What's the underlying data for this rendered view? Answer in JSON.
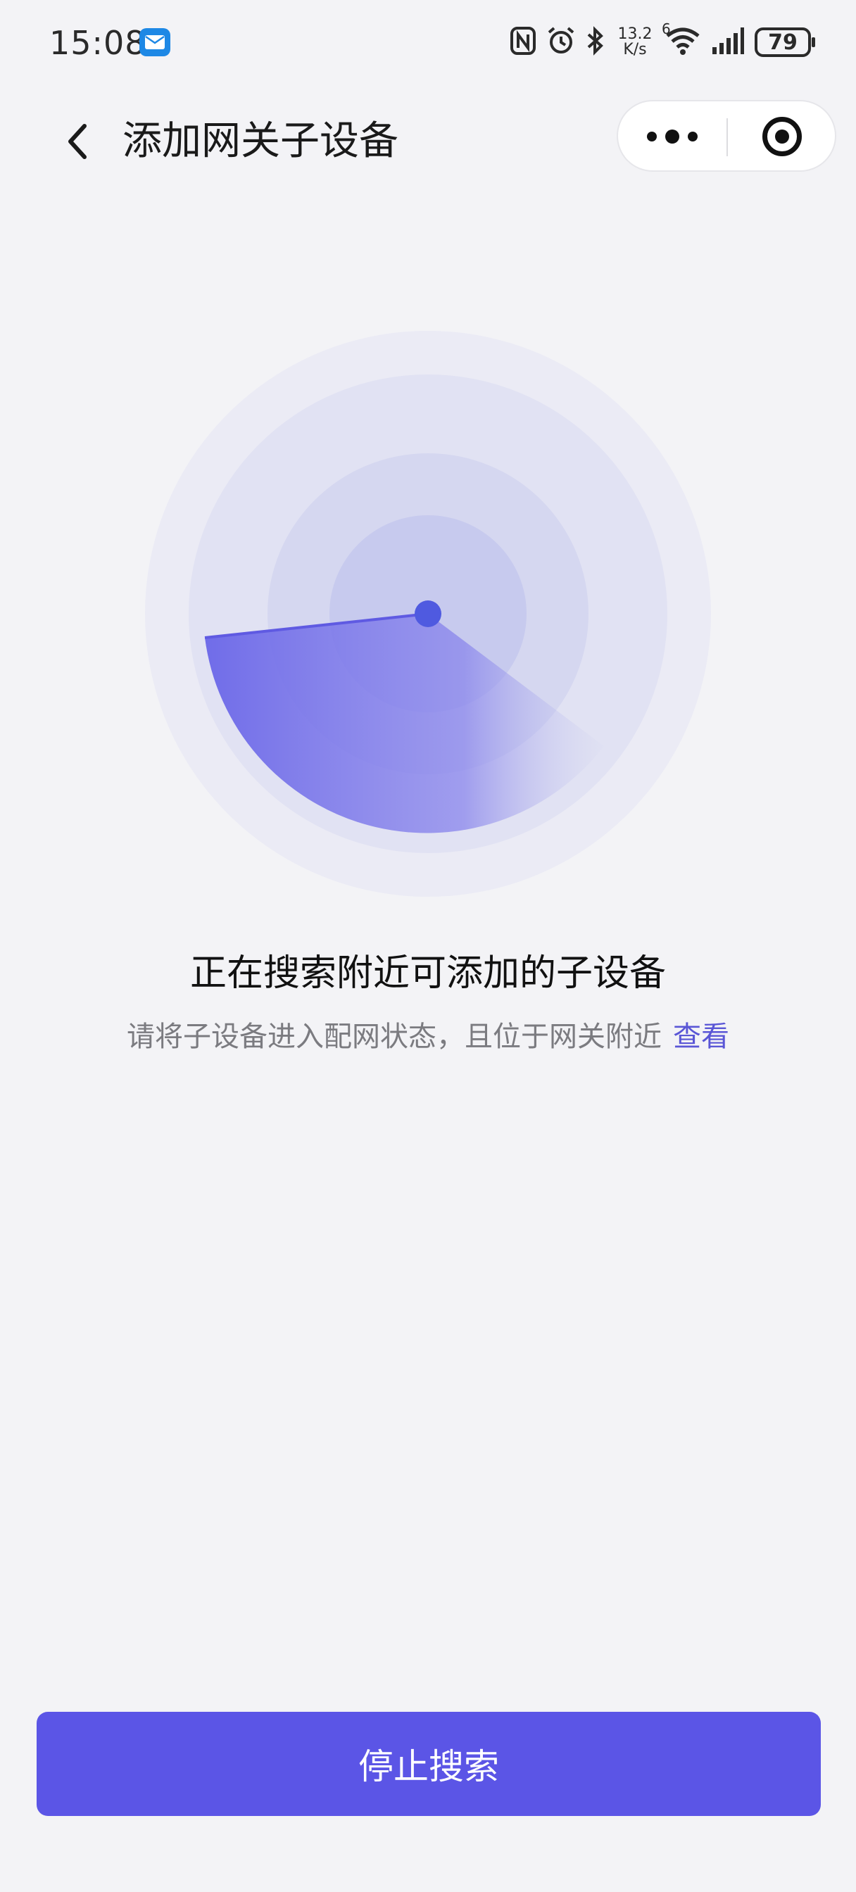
{
  "status_bar": {
    "time": "15:08",
    "net_speed_value": "13.2",
    "net_speed_unit": "K/s",
    "wifi_badge": "6",
    "battery": "79",
    "icons": [
      "mail-icon",
      "nfc-icon",
      "alarm-icon",
      "bluetooth-icon",
      "wifi-icon",
      "signal-icon",
      "battery-icon"
    ]
  },
  "nav": {
    "title": "添加网关子设备",
    "back_icon": "chevron-left-icon",
    "more_icon": "more-dots-icon",
    "close_icon": "target-icon"
  },
  "radar": {
    "colors": {
      "ring_outer": "#ebebf5",
      "ring_2": "#e1e2f3",
      "ring_3": "#d5d7f0",
      "ring_inner": "#c7caee",
      "sweep": "#6a66e8",
      "center_dot": "#4f5ae0"
    }
  },
  "main": {
    "title": "正在搜索附近可添加的子设备",
    "hint": "请将子设备进入配网状态，且位于网关附近",
    "view_link": "查看"
  },
  "footer": {
    "stop_button": "停止搜索"
  },
  "colors": {
    "accent": "#5b55e6",
    "link": "#5a56d6",
    "background": "#f3f3f6"
  }
}
